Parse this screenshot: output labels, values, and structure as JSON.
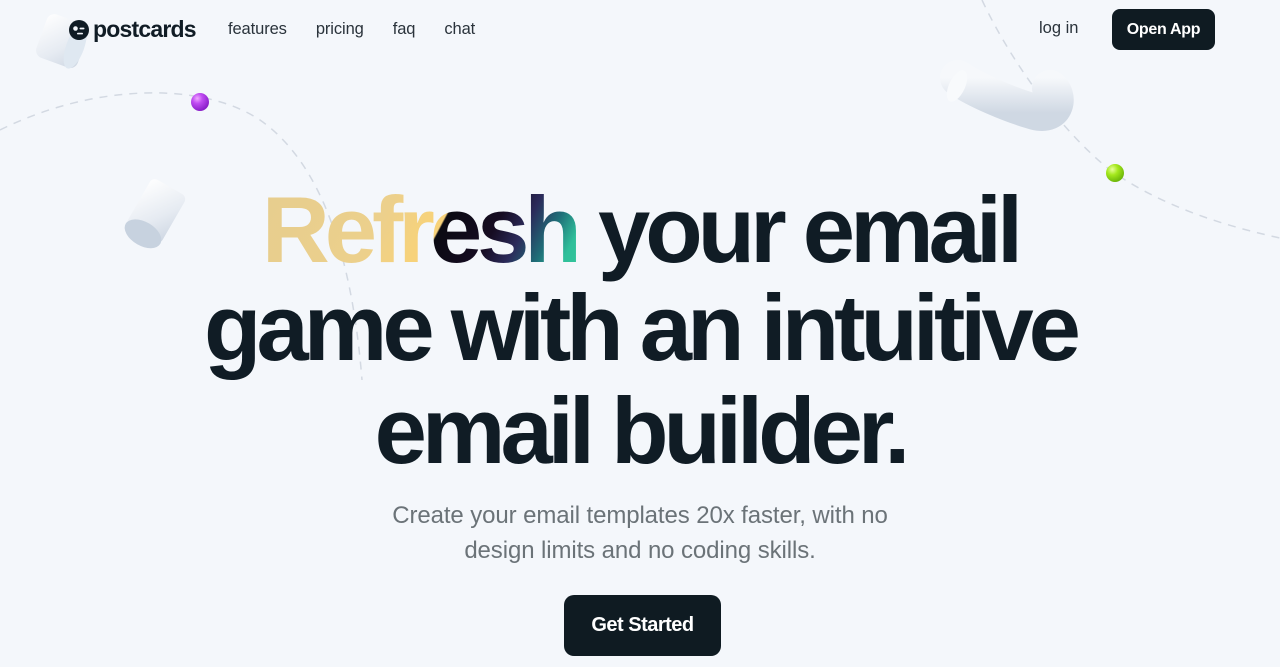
{
  "nav": {
    "brand": "postcards",
    "links": [
      {
        "label": "features"
      },
      {
        "label": "pricing"
      },
      {
        "label": "faq"
      },
      {
        "label": "chat"
      }
    ],
    "login_label": "log in",
    "open_app_label": "Open App"
  },
  "hero": {
    "headline_highlight": "Refresh",
    "headline_line1_rest": " your email",
    "headline_line2": "game with an intuitive",
    "headline_line3": "email builder.",
    "subtitle_line1": "Create your email templates 20x faster, with no",
    "subtitle_line2": "design limits and no coding skills.",
    "cta_label": "Get Started"
  },
  "theme": {
    "background": "#f4f7fb",
    "primary_dark": "#0f1b22",
    "text_muted": "#6b7378",
    "accent_ball_purple": "#b63ff0",
    "accent_ball_green": "#9be01a"
  }
}
